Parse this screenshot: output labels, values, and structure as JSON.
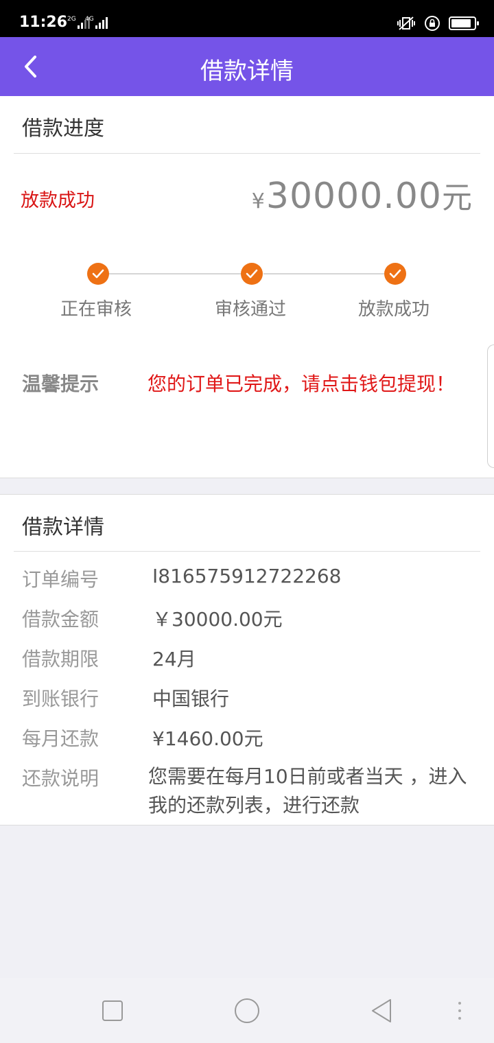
{
  "status_bar": {
    "time": "11:26",
    "sim1_label": "2G",
    "sim2_label": "4G",
    "battery_level": 0.9
  },
  "header": {
    "title": "借款详情",
    "back_icon": "chevron-left-icon"
  },
  "progress": {
    "section_title": "借款进度",
    "status": "放款成功",
    "amount_symbol": "¥",
    "amount": "30000.00",
    "amount_unit": "元",
    "steps": [
      {
        "label": "正在审核",
        "done": true
      },
      {
        "label": "审核通过",
        "done": true
      },
      {
        "label": "放款成功",
        "done": true
      }
    ],
    "tip_label": "温馨提示",
    "tip_text": "您的订单已完成，请点击钱包提现！"
  },
  "details": {
    "section_title": "借款详情",
    "rows": [
      {
        "label": "订单编号",
        "value": "I816575912722268"
      },
      {
        "label": "借款金额",
        "value": "￥30000.00元"
      },
      {
        "label": "借款期限",
        "value": "24月"
      },
      {
        "label": "到账银行",
        "value": "中国银行"
      },
      {
        "label": "每月还款",
        "value": "¥1460.00元"
      },
      {
        "label": "还款说明",
        "value": "您需要在每月10日前或者当天 ，进入我的还款列表，进行还款"
      }
    ]
  },
  "colors": {
    "header_bg": "#7554e8",
    "step_accent": "#ee7114",
    "status_red": "#d91515"
  }
}
